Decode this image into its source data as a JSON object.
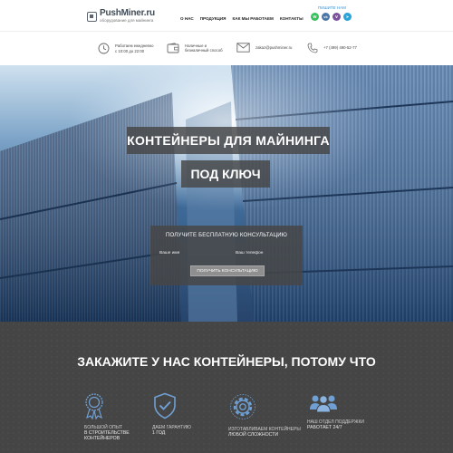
{
  "header": {
    "logo": {
      "name": "PushMiner.ru",
      "tagline": "оборудование для майнинга"
    },
    "nav": [
      "О НАС",
      "ПРОДУКЦИЯ",
      "КАК МЫ РАБОТАЕМ",
      "КОНТАКТЫ"
    ],
    "write_us": "ПИШИТЕ НАМ",
    "messengers": [
      {
        "name": "whatsapp",
        "glyph": "w",
        "color": "#38c25f"
      },
      {
        "name": "vk",
        "glyph": "vk",
        "color": "#4a76a8"
      },
      {
        "name": "viber",
        "glyph": "v",
        "color": "#7b519d"
      },
      {
        "name": "telegram",
        "glyph": "➤",
        "color": "#2aa3d8"
      }
    ],
    "info": {
      "hours": [
        "Работаем ежедневно",
        "с 10:00 до 22:00"
      ],
      "payment": [
        "Наличные и",
        "безналичный способ"
      ],
      "email": "zakaz@pushminer.ru",
      "phone": "+7 (499) 490-52-77"
    }
  },
  "hero": {
    "title_line1": "КОНТЕЙНЕРЫ ДЛЯ МАЙНИНГА",
    "title_line2": "ПОД КЛЮЧ",
    "form": {
      "title": "ПОЛУЧИТЕ БЕСПЛАТНУЮ КОНСУЛЬТАЦИЮ",
      "name_placeholder": "Ваше имя",
      "phone_placeholder": "Ваш телефон",
      "submit_label": "ПОЛУЧИТЬ КОНСУЛЬТАЦИЮ"
    }
  },
  "benefits": {
    "title": "ЗАКАЖИТЕ У НАС КОНТЕЙНЕРЫ, ПОТОМУ ЧТО",
    "items": [
      {
        "icon": "award-icon",
        "line1": "БОЛЬШОЙ ОПЫТ",
        "line2": "В СТРОИТЕЛЬСТВЕ",
        "line3": "КОНТЕЙНЕРОВ"
      },
      {
        "icon": "shield-check-icon",
        "line1": "ДАЕМ ГАРАНТИЮ",
        "line2": "1 ГОД",
        "line3": ""
      },
      {
        "icon": "gear-icon",
        "line1": "ИЗГОТАВЛИВАЕМ КОНТЕЙНЕРЫ",
        "line2": "ЛЮБОЙ СЛОЖНОСТИ",
        "line3": ""
      },
      {
        "icon": "team-icon",
        "line1": "НАШ ОТДЕЛ ПОДДЕРЖКИ",
        "line2": "РАБОТАЕТ 24/7",
        "line3": ""
      }
    ]
  },
  "colors": {
    "accent": "#3b8fd1",
    "icon_blue": "#6f9fd3",
    "dark_bg": "#454545"
  }
}
